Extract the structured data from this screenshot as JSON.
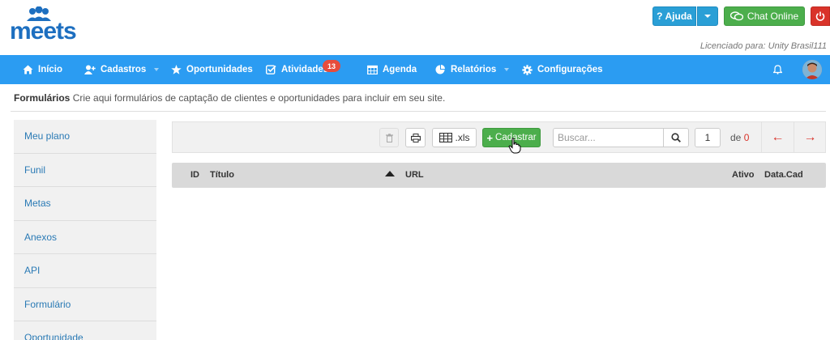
{
  "brand": {
    "logo_text": "meets",
    "logo_color": "#1d6fc0"
  },
  "top_actions": {
    "help_label": "Ajuda",
    "chat_label": "Chat Online"
  },
  "license_text": "Licenciado para: Unity Brasil111",
  "navbar": {
    "color": "#2b9cf2",
    "items": [
      {
        "label": "Início",
        "icon": "home-icon"
      },
      {
        "label": "Cadastros",
        "icon": "user-plus-icon",
        "dropdown": true
      },
      {
        "label": "Oportunidades",
        "icon": "star-icon"
      },
      {
        "label": "Atividades",
        "icon": "check-square-icon",
        "badge": "13"
      },
      {
        "label": "Agenda",
        "icon": "calendar-icon"
      },
      {
        "label": "Relatórios",
        "icon": "pie-chart-icon",
        "dropdown": true
      },
      {
        "label": "Configurações",
        "icon": "gear-icon"
      }
    ]
  },
  "page_header": {
    "title": "Formulários",
    "description": "Crie aqui formulários de captação de clientes e oportunidades para incluir em seu site."
  },
  "sidebar": {
    "items": [
      {
        "label": "Meu plano"
      },
      {
        "label": "Funil"
      },
      {
        "label": "Metas"
      },
      {
        "label": "Anexos"
      },
      {
        "label": "API"
      },
      {
        "label": "Formulário"
      },
      {
        "label": "Oportunidade"
      }
    ]
  },
  "toolbar": {
    "xls_label": ".xls",
    "add_label": "Cadastrar",
    "search_placeholder": "Buscar...",
    "page_value": "1",
    "page_of_label": "de",
    "page_total": "0"
  },
  "table": {
    "columns": [
      "ID",
      "Título",
      "URL",
      "Ativo",
      "Data.Cad"
    ],
    "rows": []
  }
}
